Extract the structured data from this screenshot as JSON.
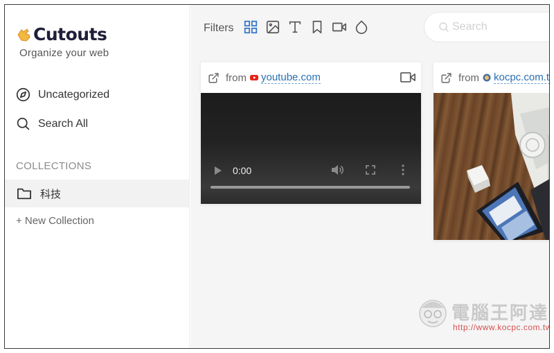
{
  "app": {
    "name": "Cutouts",
    "tagline": "Organize your web"
  },
  "sidebar": {
    "nav": [
      {
        "label": "Uncategorized",
        "icon": "compass-icon"
      },
      {
        "label": "Search All",
        "icon": "search-icon"
      }
    ],
    "collections_heading": "COLLECTIONS",
    "collections": [
      {
        "label": "科技",
        "icon": "folder-icon",
        "selected": true
      }
    ],
    "new_collection_label": "+ New Collection"
  },
  "toolbar": {
    "filters_label": "Filters",
    "filters": [
      {
        "icon": "grid-icon",
        "active": true
      },
      {
        "icon": "image-icon",
        "active": false
      },
      {
        "icon": "text-icon",
        "active": false
      },
      {
        "icon": "bookmark-icon",
        "active": false
      },
      {
        "icon": "video-icon",
        "active": false
      },
      {
        "icon": "drop-icon",
        "active": false
      }
    ],
    "search_placeholder": "Search"
  },
  "cards": [
    {
      "from_label": "from",
      "site": "youtube.com",
      "site_icon": "youtube-icon",
      "type_icon": "video-icon",
      "video_time": "0:00"
    },
    {
      "from_label": "from",
      "site": "kocpc.com.tw",
      "site_icon": "kocpc-favicon"
    }
  ],
  "watermark": {
    "title": "電腦王阿達",
    "url": "http://www.kocpc.com.tw"
  },
  "colors": {
    "accent": "#2a6fb0",
    "active_filter": "#3a79c8",
    "youtube_red": "#e62117",
    "selected_row": "#f2f2f2",
    "main_bg": "#f5f5f5"
  }
}
